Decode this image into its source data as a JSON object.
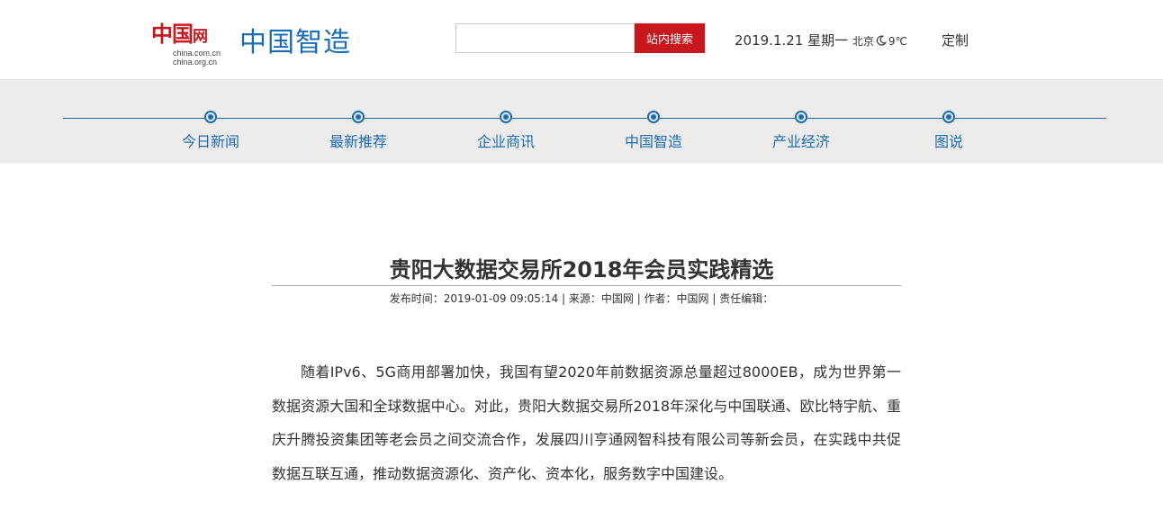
{
  "header": {
    "logo": {
      "brand": "中国",
      "net": "网",
      "domain1": "china.com.cn",
      "domain2": "china.org.cn"
    },
    "channel_title": "中国智造",
    "search": {
      "value": "",
      "placeholder": "",
      "button_label": "站内搜索"
    },
    "date": "2019.1.21 星期一",
    "city": "北京",
    "weather_icon": "crescent-moon-icon",
    "temperature": "9℃",
    "customize_label": "定制"
  },
  "nav": {
    "items": [
      {
        "label": "今日新闻"
      },
      {
        "label": "最新推荐"
      },
      {
        "label": "企业商讯"
      },
      {
        "label": "中国智造"
      },
      {
        "label": "产业经济"
      },
      {
        "label": "图说"
      }
    ]
  },
  "article": {
    "title": "贵阳大数据交易所2018年会员实践精选",
    "meta": "发布时间：2019-01-09 09:05:14 | 来源：中国网 | 作者：中国网 | 责任编辑：",
    "paragraph": "随着IPv6、5G商用部署加快，我国有望2020年前数据资源总量超过8000EB，成为世界第一数据资源大国和全球数据中心。对此，贵阳大数据交易所2018年深化与中国联通、欧比特宇航、重庆升腾投资集团等老会员之间交流合作，发展四川亨通网智科技有限公司等新会员，在实践中共促数据互联互通，推动数据资源化、资产化、资本化，服务数字中国建设。"
  },
  "colors": {
    "brand_red": "#c9171e",
    "nav_blue": "#1a6cb4",
    "nav_band": "#edeceb"
  }
}
